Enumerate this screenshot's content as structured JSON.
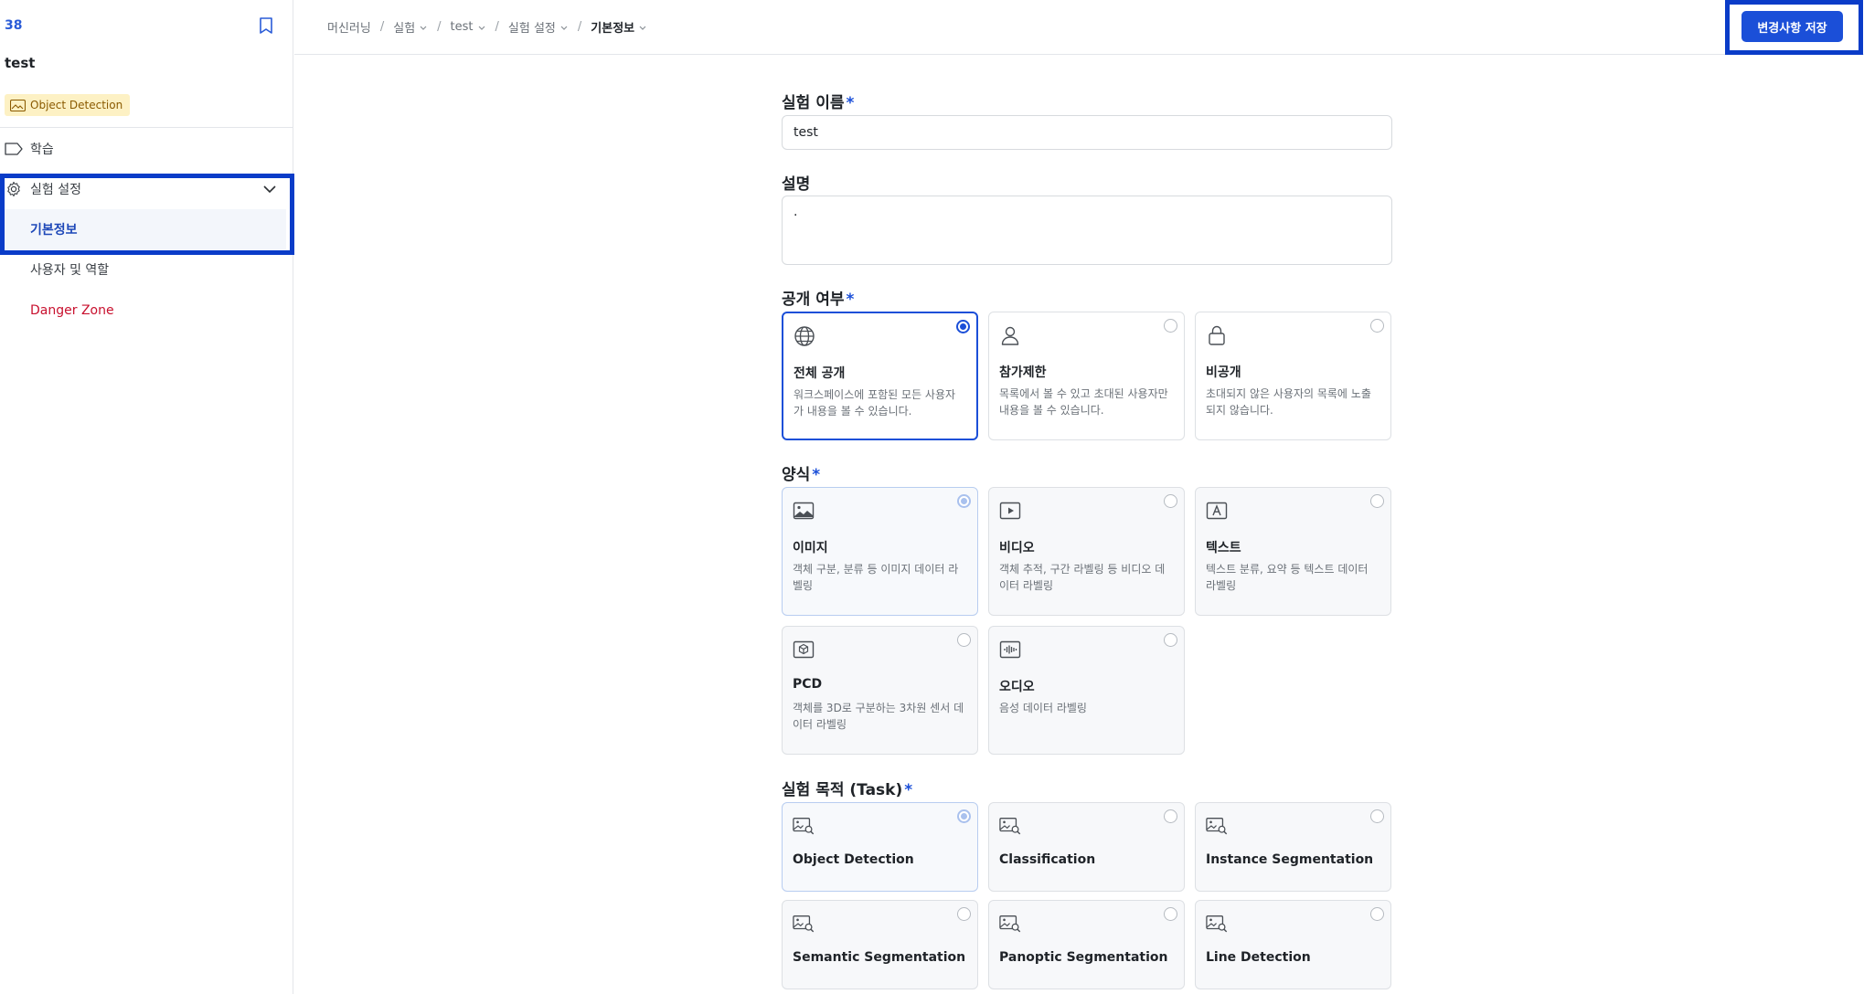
{
  "sidebar": {
    "id": "38",
    "name": "test",
    "badge": "Object Detection",
    "menu": {
      "learn": "학습",
      "settings": "실험 설정",
      "basic_info": "기본정보",
      "users_roles": "사용자 및 역할",
      "danger_zone": "Danger Zone"
    }
  },
  "breadcrumb": {
    "items": [
      "머신러닝",
      "실험",
      "test",
      "실험 설정",
      "기본정보"
    ],
    "separator": "/"
  },
  "toolbar": {
    "save_label": "변경사항 저장"
  },
  "form": {
    "required_mark": "*",
    "name_label": "실험 이름",
    "name_value": "test",
    "desc_label": "설명",
    "desc_value": ".",
    "visibility_label": "공개 여부",
    "visibility_options": [
      {
        "title": "전체 공개",
        "desc": "워크스페이스에 포함된 모든 사용자가 내용을 볼 수 있습니다.",
        "icon": "globe-icon",
        "selected": true
      },
      {
        "title": "참가제한",
        "desc": "목록에서 볼 수 있고 초대된 사용자만 내용을 볼 수 있습니다.",
        "icon": "user-icon",
        "selected": false
      },
      {
        "title": "비공개",
        "desc": "초대되지 않은 사용자의 목록에 노출되지 않습니다.",
        "icon": "lock-icon",
        "selected": false
      }
    ],
    "modality_label": "양식",
    "modality_options": [
      {
        "title": "이미지",
        "desc": "객체 구분, 분류 등 이미지 데이터 라벨링",
        "icon": "image-icon",
        "selected": true
      },
      {
        "title": "비디오",
        "desc": "객체 추적, 구간 라벨링 등 비디오 데이터 라벨링",
        "icon": "video-icon",
        "selected": false
      },
      {
        "title": "텍스트",
        "desc": "텍스트 분류, 요약 등 텍스트 데이터 라벨링",
        "icon": "text-icon",
        "selected": false
      },
      {
        "title": "PCD",
        "desc": "객체를 3D로 구분하는 3차원 센서 데이터 라벨링",
        "icon": "cube-icon",
        "selected": false
      },
      {
        "title": "오디오",
        "desc": "음성 데이터 라벨링",
        "icon": "audio-icon",
        "selected": false
      }
    ],
    "task_label": "실험 목적 (Task)",
    "task_options": [
      {
        "title": "Object Detection",
        "selected": true
      },
      {
        "title": "Classification",
        "selected": false
      },
      {
        "title": "Instance Segmentation",
        "selected": false
      },
      {
        "title": "Semantic Segmentation",
        "selected": false
      },
      {
        "title": "Panoptic Segmentation",
        "selected": false
      },
      {
        "title": "Line Detection",
        "selected": false
      }
    ]
  },
  "colors": {
    "accent": "#1b4fd8",
    "highlight_box": "#0a3cc8",
    "danger": "#c8102e",
    "badge_bg": "#fdf1c4"
  }
}
